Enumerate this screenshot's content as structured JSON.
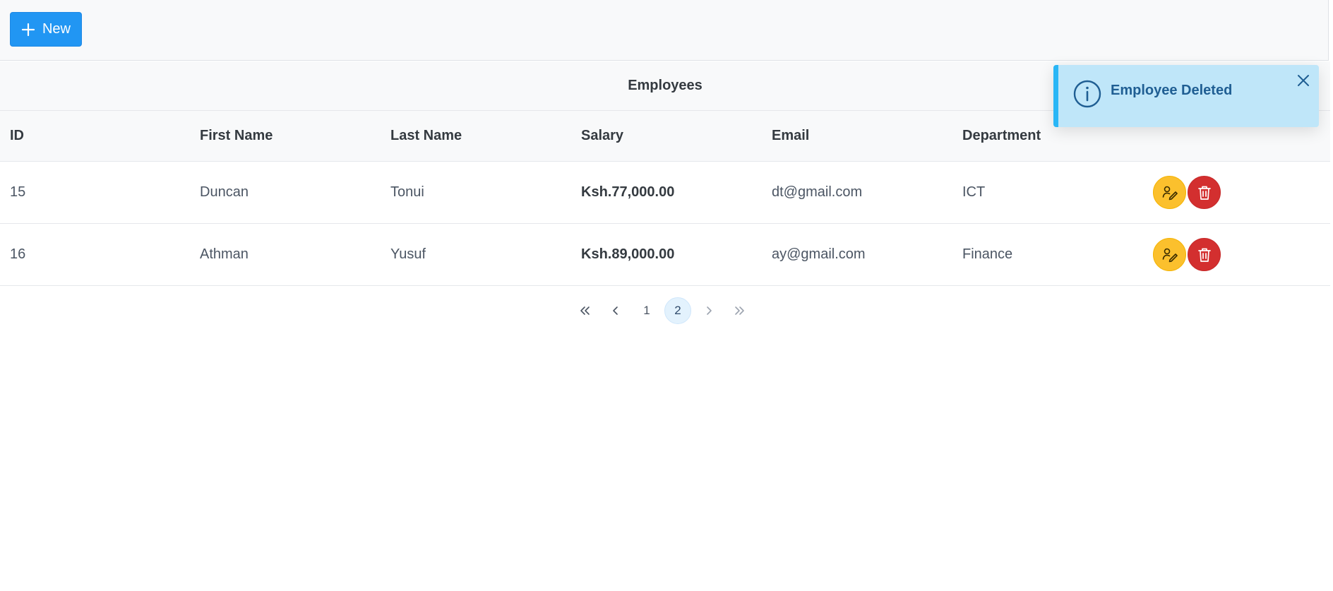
{
  "toolbar": {
    "new_label": "New"
  },
  "table": {
    "title": "Employees",
    "headers": [
      "ID",
      "First Name",
      "Last Name",
      "Salary",
      "Email",
      "Department"
    ],
    "rows": [
      {
        "id": "15",
        "first_name": "Duncan",
        "last_name": "Tonui",
        "salary": "Ksh.77,000.00",
        "email": "dt@gmail.com",
        "department": "ICT"
      },
      {
        "id": "16",
        "first_name": "Athman",
        "last_name": "Yusuf",
        "salary": "Ksh.89,000.00",
        "email": "ay@gmail.com",
        "department": "Finance"
      }
    ]
  },
  "paginator": {
    "pages": [
      "1",
      "2"
    ],
    "current_page": "2",
    "first_icon": "double-chevron-left-icon",
    "prev_icon": "chevron-left-icon",
    "next_icon": "chevron-right-icon",
    "last_icon": "double-chevron-right-icon"
  },
  "toast": {
    "message": "Employee Deleted",
    "icon": "info-circle-icon",
    "close_icon": "close-icon"
  },
  "icons": {
    "edit": "user-edit-icon",
    "delete": "trash-icon",
    "new": "plus-icon"
  },
  "colors": {
    "primary": "#2196f3",
    "edit": "#fbc02d",
    "delete": "#d32f2f",
    "toast_bg": "#bfe6f9",
    "toast_accent": "#29b6f6",
    "toast_text": "#1f5e93"
  }
}
